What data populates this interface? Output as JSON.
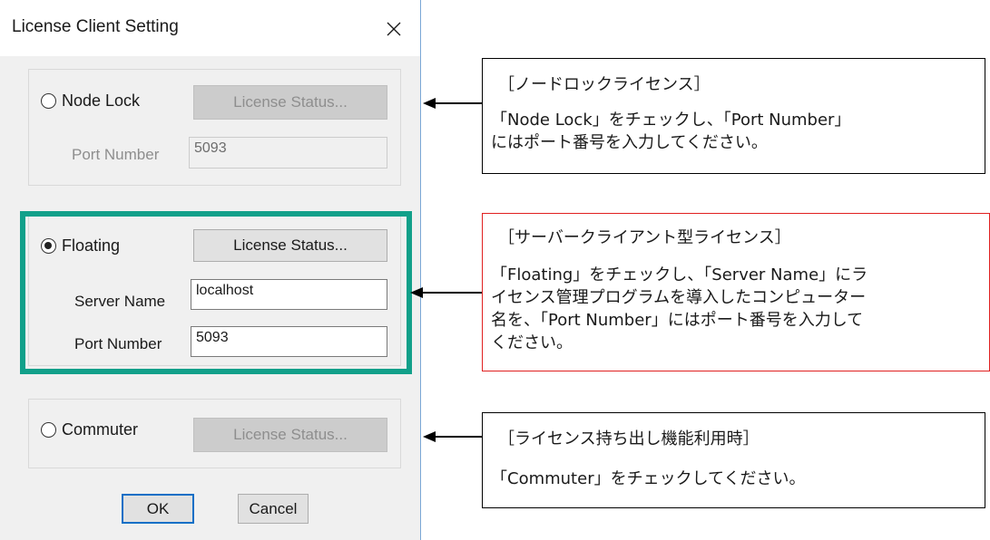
{
  "dialog": {
    "title": "License Client Setting",
    "node_lock": {
      "radio_label": "Node Lock",
      "status_button": "License Status...",
      "port_label": "Port Number",
      "port_value": "5093",
      "checked": false
    },
    "floating": {
      "radio_label": "Floating",
      "status_button": "License Status...",
      "server_label": "Server Name",
      "server_value": "localhost",
      "port_label": "Port Number",
      "port_value": "5093",
      "checked": true
    },
    "commuter": {
      "radio_label": "Commuter",
      "status_button": "License Status...",
      "checked": false
    },
    "ok_label": "OK",
    "cancel_label": "Cancel"
  },
  "callouts": {
    "node_lock": {
      "heading": "［ノードロックライセンス］",
      "body_lines": [
        "「Node Lock」をチェックし、「Port Number」",
        "にはポート番号を入力してください。"
      ]
    },
    "floating": {
      "heading": "［サーバークライアント型ライセンス］",
      "body_lines": [
        "「Floating」をチェックし、「Server Name」にラ",
        "イセンス管理プログラムを導入したコンピューター",
        "名を、「Port Number」にはポート番号を入力して",
        "ください。"
      ]
    },
    "commuter": {
      "heading": "［ライセンス持ち出し機能利用時］",
      "body_lines": [
        "「Commuter」をチェックしてください。"
      ]
    }
  },
  "colors": {
    "highlight": "#12a08a",
    "floating_callout_border": "#e02020",
    "callout_border": "#000000",
    "ok_focus": "#0f6fc6"
  },
  "icons": {
    "close": "close-icon",
    "arrow": "left-arrow-icon"
  }
}
